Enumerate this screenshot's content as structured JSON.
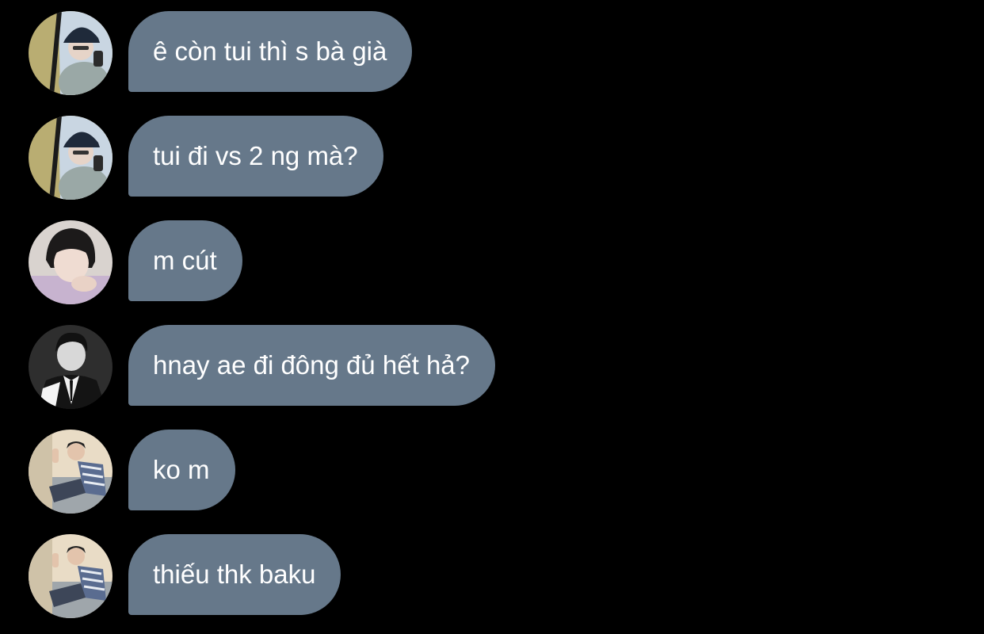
{
  "messages": [
    {
      "avatar": "avatar-bucket-hat-selfie",
      "text": "ê còn tui thì s bà già"
    },
    {
      "avatar": "avatar-bucket-hat-selfie",
      "text": "tui đi vs 2 ng mà?"
    },
    {
      "avatar": "avatar-girl-short-hair",
      "text": "m cút"
    },
    {
      "avatar": "avatar-bw-suit-portrait",
      "text": "hnay ae đi đông đủ hết hả?"
    },
    {
      "avatar": "avatar-plaid-shirt-sitting",
      "text": "ko m"
    },
    {
      "avatar": "avatar-plaid-shirt-sitting",
      "text": "thiếu thk baku"
    }
  ],
  "colors": {
    "background": "#000000",
    "bubble": "#66788a",
    "text": "#ffffff"
  }
}
